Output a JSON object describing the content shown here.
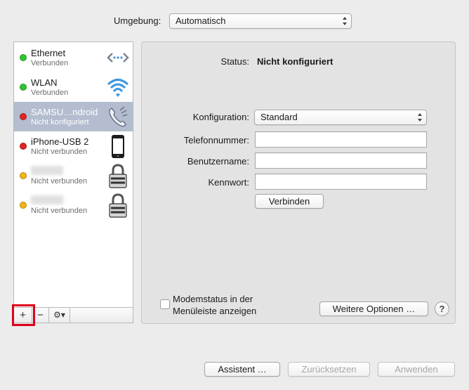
{
  "location": {
    "label": "Umgebung:",
    "value": "Automatisch"
  },
  "services": [
    {
      "name": "Ethernet",
      "status": "Verbunden",
      "dot": "#2fc62f",
      "icon": "ethernet-icon"
    },
    {
      "name": "WLAN",
      "status": "Verbunden",
      "dot": "#2fc62f",
      "icon": "wifi-icon"
    },
    {
      "name": "SAMSU…ndroid",
      "status": "Nicht konfiguriert",
      "dot": "#e02424",
      "icon": "phone-modem-icon"
    },
    {
      "name": "iPhone-USB 2",
      "status": "Nicht verbunden",
      "dot": "#e02424",
      "icon": "iphone-icon"
    },
    {
      "name": "",
      "status": "Nicht verbunden",
      "dot": "#f2b516",
      "icon": "lock-icon"
    },
    {
      "name": "",
      "status": "Nicht verbunden",
      "dot": "#f2b516",
      "icon": "lock-icon"
    }
  ],
  "toolbar": {
    "add": "+",
    "remove": "−",
    "action": "⚙▾"
  },
  "detail": {
    "status_label": "Status:",
    "status_value": "Nicht konfiguriert",
    "config_label": "Konfiguration:",
    "config_value": "Standard",
    "phone_label": "Telefonnummer:",
    "phone_value": "",
    "user_label": "Benutzername:",
    "user_value": "",
    "password_label": "Kennwort:",
    "password_value": "",
    "connect_button": "Verbinden",
    "modem_status_line1": "Modemstatus in der",
    "modem_status_line2": "Menüleiste anzeigen",
    "more_options_button": "Weitere Optionen …",
    "help": "?"
  },
  "footer": {
    "assistant_button": "Assistent …",
    "revert_button": "Zurücksetzen",
    "apply_button": "Anwenden"
  }
}
